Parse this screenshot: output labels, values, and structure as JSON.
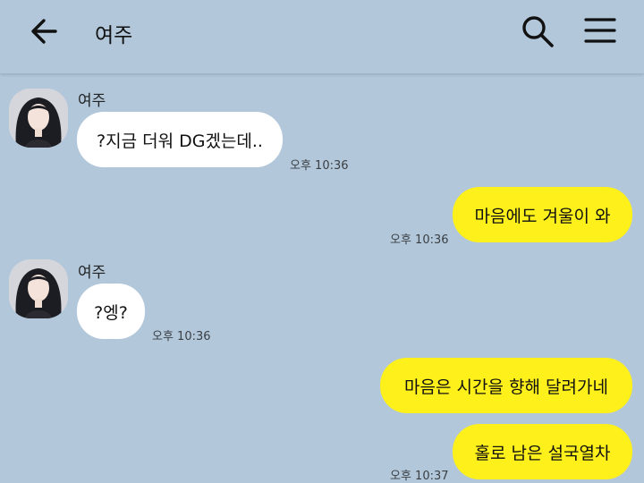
{
  "header": {
    "title": "여주",
    "back_icon": "arrow-left-icon",
    "search_icon": "search-icon",
    "menu_icon": "hamburger-menu-icon"
  },
  "colors": {
    "background": "#b2c7da",
    "incoming_bubble": "#ffffff",
    "outgoing_bubble": "#fef01b"
  },
  "messages": [
    {
      "direction": "incoming",
      "sender": "여주",
      "text": "?지금 더워 DG겠는데..",
      "time": "오후 10:36"
    },
    {
      "direction": "outgoing",
      "text": "마음에도 겨울이 와",
      "time": "오후 10:36"
    },
    {
      "direction": "incoming",
      "sender": "여주",
      "text": "?엥?",
      "time": "오후 10:36"
    },
    {
      "direction": "outgoing",
      "text": "마음은 시간을 향해 달려가네",
      "time": ""
    },
    {
      "direction": "outgoing",
      "text": "홀로 남은 설국열차",
      "time": "오후 10:37"
    }
  ]
}
